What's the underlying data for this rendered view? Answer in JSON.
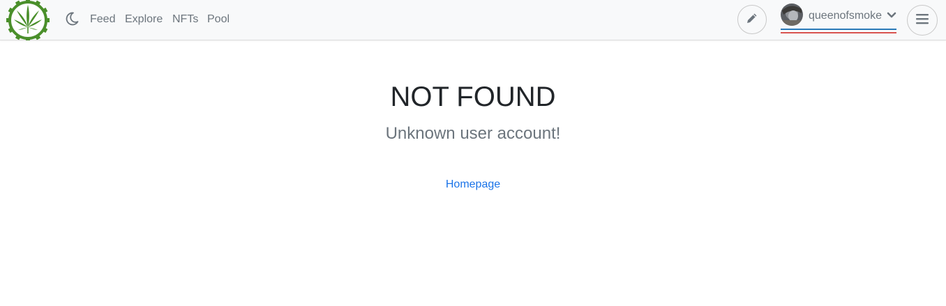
{
  "navbar": {
    "logo_name": "cannabis-leaf-logo",
    "theme_toggle_icon": "moon-icon",
    "links": [
      "Feed",
      "Explore",
      "NFTs",
      "Pool"
    ],
    "compose_icon": "pencil-icon",
    "user": {
      "username": "queenofsmoke",
      "dropdown_icon": "chevron-down-icon"
    },
    "menu_icon": "hamburger-menu-icon"
  },
  "main": {
    "title": "NOT FOUND",
    "message": "Unknown user account!",
    "home_link": "Homepage"
  },
  "colors": {
    "navbar_bg": "#f8f9fa",
    "logo_green": "#4a8f2a",
    "link_blue": "#1a73e8",
    "bar_blue": "#2a7ab8",
    "bar_red": "#d9534f"
  }
}
